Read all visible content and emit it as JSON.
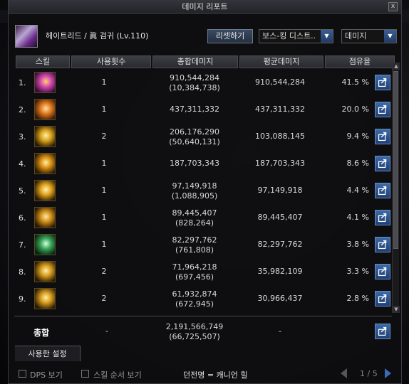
{
  "window": {
    "title": "데미지 리포트",
    "close_label": "x"
  },
  "header": {
    "character_label": "헤이트리드 / 眞 검귀 (Lv.110)",
    "reset_label": "리셋하기",
    "boss_select": "보스-킹 디스트..",
    "metric_select": "데미지"
  },
  "columns": [
    "스킬",
    "사용횟수",
    "총합데미지",
    "평균데미지",
    "점유율"
  ],
  "rows": [
    {
      "rank": "1.",
      "uses": "1",
      "total": "910,544,284",
      "total_sub": "(10,384,738)",
      "avg": "910,544,284",
      "share": "41.5  %",
      "icon": "slash-skill-icon",
      "colors": [
        "#3a0c3a",
        "#d64ab0",
        "#ffd36b"
      ]
    },
    {
      "rank": "2.",
      "uses": "1",
      "total": "437,311,332",
      "total_sub": "",
      "avg": "437,311,332",
      "share": "20.0  %",
      "icon": "burst-skill-icon",
      "colors": [
        "#3a1a06",
        "#e07a1e",
        "#ffe1a0"
      ]
    },
    {
      "rank": "3.",
      "uses": "2",
      "total": "206,176,290",
      "total_sub": "(50,640,131)",
      "avg": "103,088,145",
      "share": "9.4  %",
      "icon": "crescent-skill-icon",
      "colors": [
        "#2a1a04",
        "#d8a21c",
        "#fff0a8"
      ]
    },
    {
      "rank": "4.",
      "uses": "1",
      "total": "187,703,343",
      "total_sub": "",
      "avg": "187,703,343",
      "share": "8.6  %",
      "icon": "spin-skill-icon",
      "colors": [
        "#2a1a04",
        "#d88e14",
        "#fff0a0"
      ]
    },
    {
      "rank": "5.",
      "uses": "1",
      "total": "97,149,918",
      "total_sub": "(1,088,905)",
      "avg": "97,149,918",
      "share": "4.4  %",
      "icon": "wave-skill-icon",
      "colors": [
        "#2a1a04",
        "#e0a21c",
        "#fff3b0"
      ]
    },
    {
      "rank": "6.",
      "uses": "1",
      "total": "89,445,407",
      "total_sub": "(828,264)",
      "avg": "89,445,407",
      "share": "4.1  %",
      "icon": "flash-skill-icon",
      "colors": [
        "#2a1604",
        "#cf8f18",
        "#ffe7a0"
      ]
    },
    {
      "rank": "7.",
      "uses": "1",
      "total": "82,297,762",
      "total_sub": "(761,808)",
      "avg": "82,297,762",
      "share": "3.8  %",
      "icon": "leaf-skill-icon",
      "colors": [
        "#06260e",
        "#3aa45a",
        "#d6ffd8"
      ]
    },
    {
      "rank": "8.",
      "uses": "2",
      "total": "71,964,218",
      "total_sub": "(697,456)",
      "avg": "35,982,109",
      "share": "3.3  %",
      "icon": "arc-skill-icon",
      "colors": [
        "#2a1a04",
        "#d69a1c",
        "#fff0a8"
      ]
    },
    {
      "rank": "9.",
      "uses": "2",
      "total": "61,932,874",
      "total_sub": "(672,945)",
      "avg": "30,966,437",
      "share": "2.8  %",
      "icon": "edge-skill-icon",
      "colors": [
        "#2a1a04",
        "#d69a1c",
        "#fff0a8"
      ]
    }
  ],
  "totals": {
    "label": "총합",
    "uses": "-",
    "total": "2,191,566,749",
    "total_sub": "(66,725,507)",
    "avg": "-"
  },
  "settings_tab": "사용한 설정",
  "footer": {
    "dps_label": "DPS 보기",
    "order_label": "스킬 순서 보기",
    "dungeon": "던전명 = 캐니언 힐",
    "page": "1 / 5"
  }
}
